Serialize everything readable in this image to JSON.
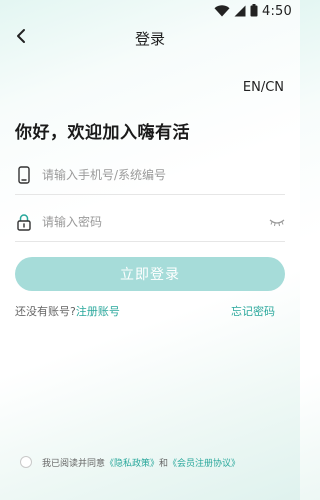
{
  "status_bar": {
    "time": "4:50",
    "icons": [
      "wifi-icon",
      "cellular-signal-icon",
      "battery-icon"
    ]
  },
  "nav": {
    "title": "登录",
    "back_icon": "chevron-left-icon"
  },
  "language_toggle": "EN/CN",
  "greeting": "你好，欢迎加入嗨有活",
  "phone_field": {
    "icon": "phone-icon",
    "placeholder": "请输入手机号/系统编号",
    "value": ""
  },
  "password_field": {
    "icon": "lock-icon",
    "placeholder": "请输入密码",
    "value": "",
    "toggle_icon": "eye-closed-icon"
  },
  "login_button": {
    "label": "立即登录"
  },
  "links": {
    "no_account": "还没有账号?",
    "register": "注册账号",
    "forgot_password": "忘记密码"
  },
  "agreement": {
    "checked": false,
    "prefix": "我已阅读并同意",
    "privacy_policy": "《隐私政策》",
    "conjunction": "和",
    "member_agreement": "《会员注册协议》"
  },
  "colors": {
    "accent": "#2aa89c",
    "button_bg": "#a6dcd9",
    "text": "#222222",
    "placeholder": "#9a9a9a"
  }
}
